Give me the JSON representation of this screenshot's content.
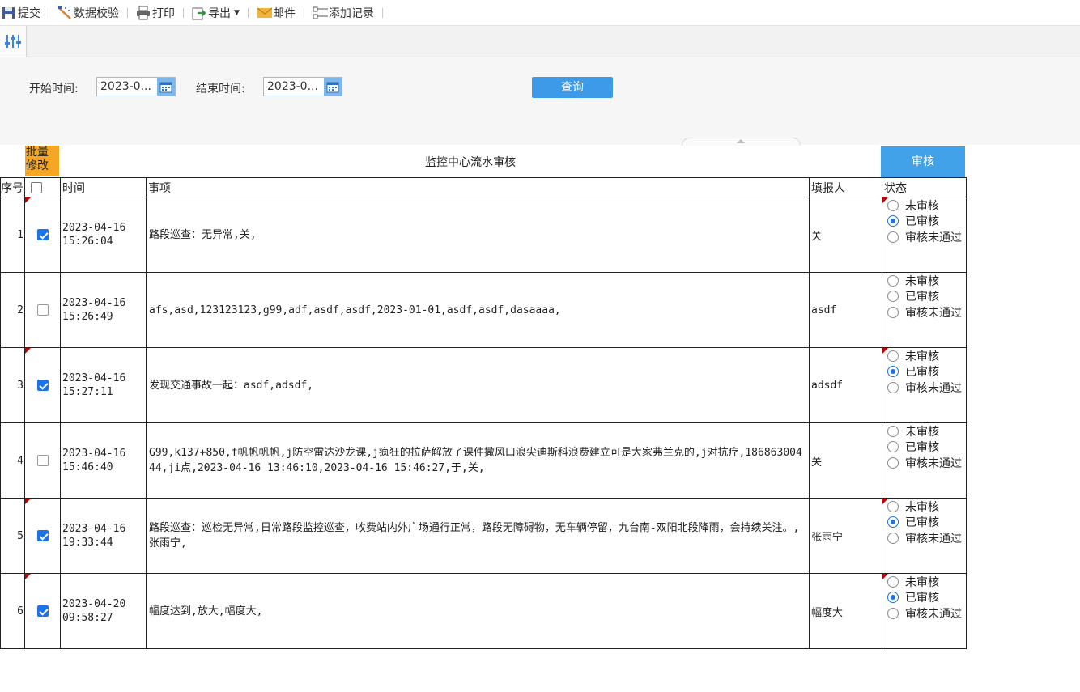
{
  "toolbar": {
    "submit": "提交",
    "validate": "数据校验",
    "print": "打印",
    "export": "导出",
    "mail": "邮件",
    "add_record": "添加记录"
  },
  "params": {
    "start_label": "开始时间:",
    "start_value": "2023-0...",
    "end_label": "结束时间:",
    "end_value": "2023-0...",
    "query": "查询"
  },
  "report": {
    "batch_edit": "批量修改",
    "title": "监控中心流水审核",
    "audit_button": "审核"
  },
  "columns": {
    "seq": "序号",
    "time": "时间",
    "item": "事项",
    "reporter": "填报人",
    "status": "状态"
  },
  "status_options": [
    "未审核",
    "已审核",
    "审核未通过"
  ],
  "rows": [
    {
      "seq": "1",
      "checked": true,
      "date": "2023-04-16",
      "time": "15:26:04",
      "item": "路段巡查：无异常,关,",
      "reporter": "关",
      "status": 1,
      "flag": true
    },
    {
      "seq": "2",
      "checked": false,
      "date": "2023-04-16",
      "time": "15:26:49",
      "item": "afs,asd,123123123,g99,adf,asdf,asdf,2023-01-01,asdf,asdf,dasaaaa,",
      "reporter": "asdf",
      "status": -1,
      "flag": false
    },
    {
      "seq": "3",
      "checked": true,
      "date": "2023-04-16",
      "time": "15:27:11",
      "item": "发现交通事故一起：asdf,adsdf,",
      "reporter": "adsdf",
      "status": 1,
      "flag": true
    },
    {
      "seq": "4",
      "checked": false,
      "date": "2023-04-16",
      "time": "15:46:40",
      "item": "G99,k137+850,f帆帆帆帆,j防空雷达沙龙课,j疯狂的拉萨解放了课件撒风口浪尖迪斯科浪费建立可是大家弗兰克的,j对抗疗,18686300444,ji点,2023-04-16 13:46:10,2023-04-16 15:46:27,于,关,",
      "reporter": "关",
      "status": -1,
      "flag": false
    },
    {
      "seq": "5",
      "checked": true,
      "date": "2023-04-16",
      "time": "19:33:44",
      "item": "路段巡查：巡检无异常,日常路段监控巡查，收费站内外广场通行正常，路段无障碍物，无车辆停留，九台南-双阳北段降雨，会持续关注。,张雨宁,",
      "reporter": "张雨宁",
      "status": 1,
      "flag": true
    },
    {
      "seq": "6",
      "checked": true,
      "date": "2023-04-20",
      "time": "09:58:27",
      "item": "幅度达到,放大,幅度大,",
      "reporter": "幅度大",
      "status": 1,
      "flag": true
    }
  ]
}
